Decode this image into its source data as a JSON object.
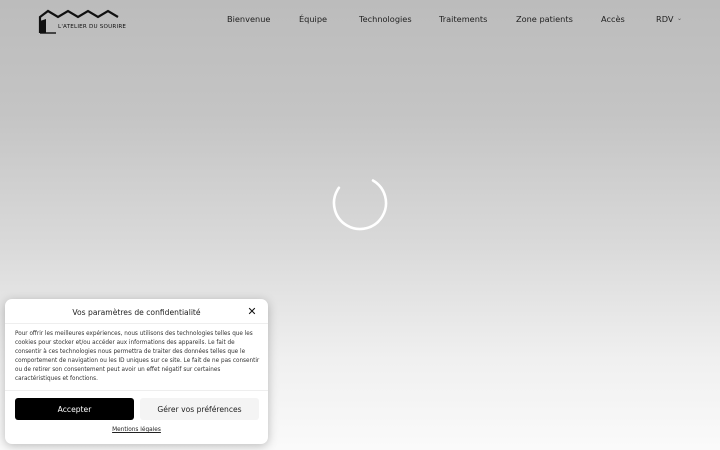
{
  "header": {
    "logo_text": "L'ATELIER DU SOURIRE",
    "nav": [
      {
        "label": "Bienvenue"
      },
      {
        "label": "Équipe"
      },
      {
        "label": "Technologies"
      },
      {
        "label": "Traitements"
      },
      {
        "label": "Zone patients"
      },
      {
        "label": "Accès"
      },
      {
        "label": "RDV",
        "chevron": "chevron-down-icon"
      }
    ]
  },
  "loader": {
    "icon": "loading-spinner-icon"
  },
  "cookie_banner": {
    "title": "Vos paramètres de confidentialité",
    "close_icon": "close-icon",
    "body": "Pour offrir les meilleures expériences, nous utilisons des technologies telles que les cookies pour stocker et/ou accéder aux informations des appareils. Le fait de consentir à ces technologies nous permettra de traiter des données telles que le comportement de navigation ou les ID uniques sur ce site. Le fait de ne pas consentir ou de retirer son consentement peut avoir un effet négatif sur certaines caractéristiques et fonctions.",
    "accept_label": "Accepter",
    "preferences_label": "Gérer vos préférences",
    "legal_link": "Mentions légales"
  }
}
